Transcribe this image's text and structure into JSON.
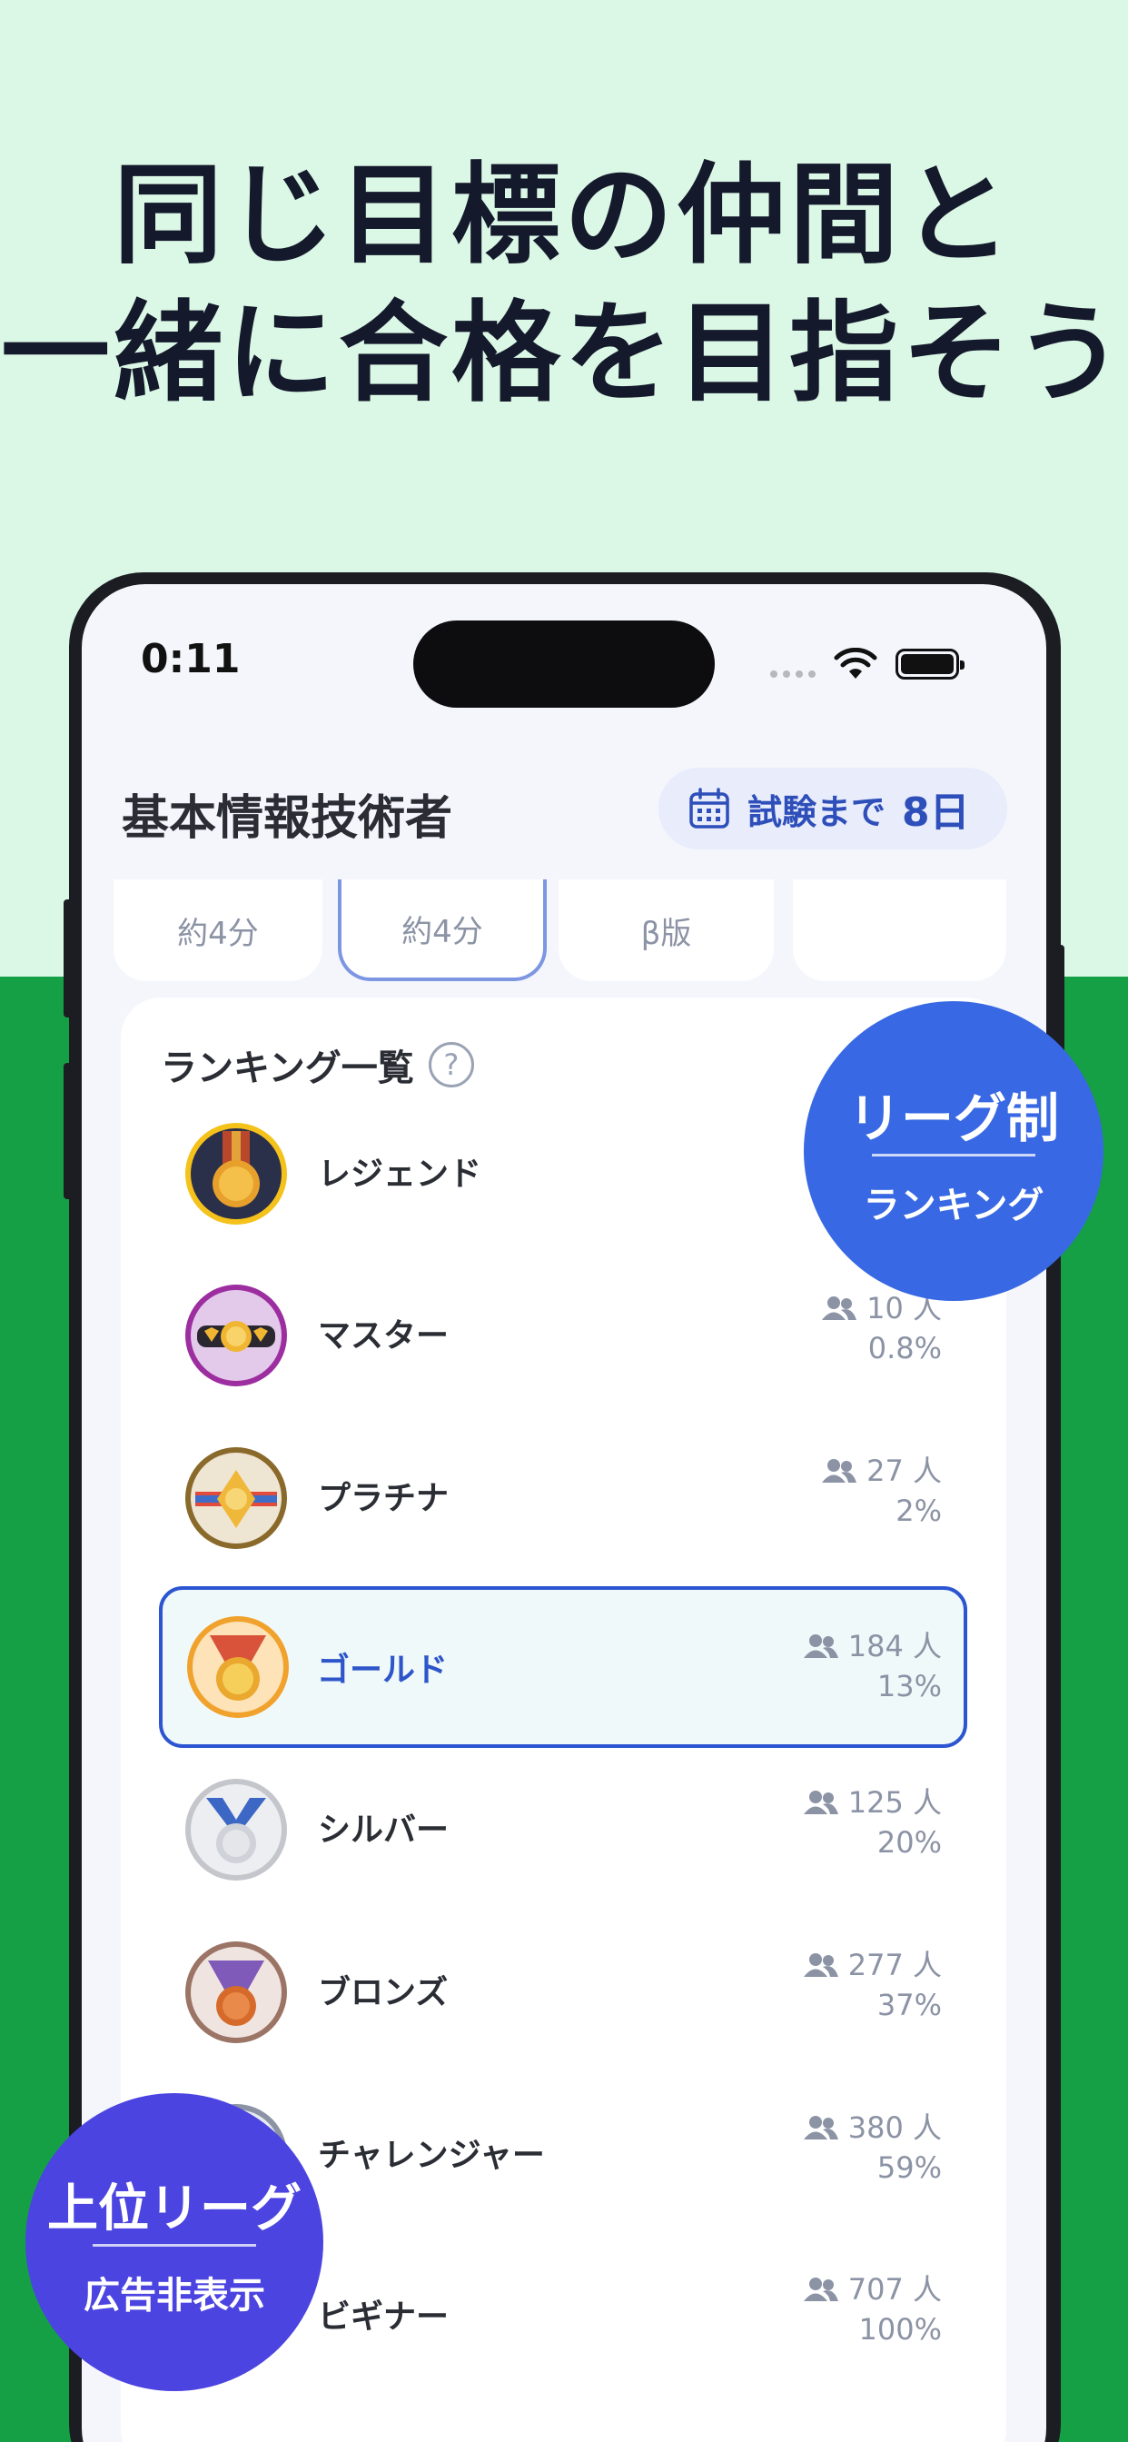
{
  "headline": {
    "line1": "同じ目標の仲間と",
    "line2": "一緒に合格を目指そう"
  },
  "status_bar": {
    "time": "0:11"
  },
  "header": {
    "title": "基本情報技術者",
    "exam_label": "試験まで",
    "exam_days": "8日"
  },
  "chips": [
    {
      "label": "約4分"
    },
    {
      "label": "約4分"
    },
    {
      "label": "β版"
    },
    {
      "label": ""
    }
  ],
  "ranking": {
    "title": "ランキング一覧",
    "help": "?",
    "leagues": [
      {
        "name": "レジェンド",
        "count": "",
        "percent": ""
      },
      {
        "name": "マスター",
        "count": "10 人",
        "percent": "0.8%"
      },
      {
        "name": "プラチナ",
        "count": "27 人",
        "percent": "2%"
      },
      {
        "name": "ゴールド",
        "count": "184 人",
        "percent": "13%",
        "selected": true
      },
      {
        "name": "シルバー",
        "count": "125 人",
        "percent": "20%"
      },
      {
        "name": "ブロンズ",
        "count": "277 人",
        "percent": "37%"
      },
      {
        "name": "チャレンジャー",
        "count": "380 人",
        "percent": "59%"
      },
      {
        "name": "ビギナー",
        "count": "707 人",
        "percent": "100%"
      }
    ]
  },
  "badges": {
    "league": {
      "line1": "リーグ制",
      "line2": "ランキング"
    },
    "upper": {
      "line1": "上位リーグ",
      "line2": "広告非表示"
    }
  },
  "colors": {
    "bg_light": "#dbf7e6",
    "bg_green": "#15a046",
    "accent_blue": "#2e55c9",
    "badge_blue": "#3868e3",
    "badge_purple": "#4b44e0"
  }
}
